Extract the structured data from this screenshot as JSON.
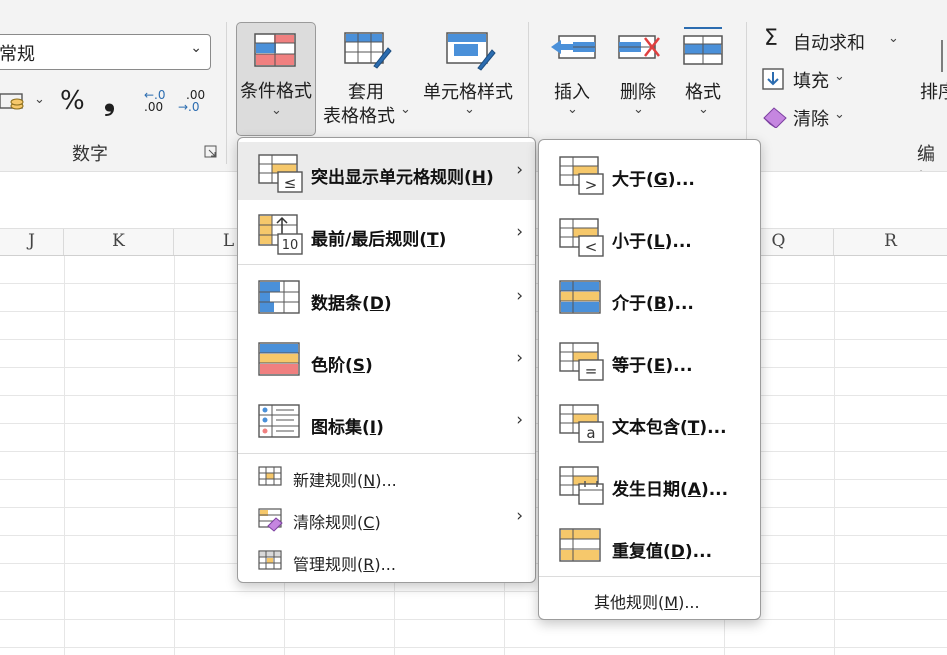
{
  "ribbon": {
    "number_format_value": "常规",
    "percent_symbol": "%",
    "comma_symbol": "❟",
    "decrease_decimal": ".00",
    "increase_decimal": ".00",
    "dec_small": "←.0",
    "inc_small": "→.0",
    "number_group_label": "数字",
    "conditional_format_label": "条件格式",
    "format_as_table_line1": "套用",
    "format_as_table_line2": "表格格式",
    "cell_styles_label": "单元格样式",
    "insert_label": "插入",
    "delete_label": "删除",
    "format_label": "格式",
    "autosum_label": "自动求和",
    "fill_label": "填充",
    "clear_label": "清除",
    "sort_label": "排序",
    "editing_group_label": "编辑"
  },
  "columns": [
    "J",
    "K",
    "L",
    "Q",
    "R"
  ],
  "main_menu": {
    "items": [
      {
        "label": "突出显示单元格规则",
        "hotkey": "H",
        "icon": "highlight-cells-icon"
      },
      {
        "label": "最前/最后规则",
        "hotkey": "T",
        "icon": "top-bottom-icon"
      },
      {
        "label": "数据条",
        "hotkey": "D",
        "icon": "data-bars-icon"
      },
      {
        "label": "色阶",
        "hotkey": "S",
        "icon": "color-scales-icon"
      },
      {
        "label": "图标集",
        "hotkey": "I",
        "icon": "icon-sets-icon"
      }
    ],
    "actions": [
      {
        "label": "新建规则",
        "hotkey": "N",
        "suffix": "..."
      },
      {
        "label": "清除规则",
        "hotkey": "C",
        "suffix": ""
      },
      {
        "label": "管理规则",
        "hotkey": "R",
        "suffix": "..."
      }
    ]
  },
  "sub_menu": {
    "items": [
      {
        "label": "大于",
        "hotkey": "G",
        "glyph": ">"
      },
      {
        "label": "小于",
        "hotkey": "L",
        "glyph": "<"
      },
      {
        "label": "介于",
        "hotkey": "B",
        "glyph": ""
      },
      {
        "label": "等于",
        "hotkey": "E",
        "glyph": "="
      },
      {
        "label": "文本包含",
        "hotkey": "T",
        "glyph": "a"
      },
      {
        "label": "发生日期",
        "hotkey": "A",
        "glyph": ""
      },
      {
        "label": "重复值",
        "hotkey": "D",
        "glyph": ""
      }
    ],
    "more_rules": {
      "label": "其他规则",
      "hotkey": "M"
    }
  },
  "colors": {
    "highlight_orange": "#f6c86b",
    "blue": "#4a90d9",
    "red": "#f08080",
    "grid_border": "#555555"
  }
}
